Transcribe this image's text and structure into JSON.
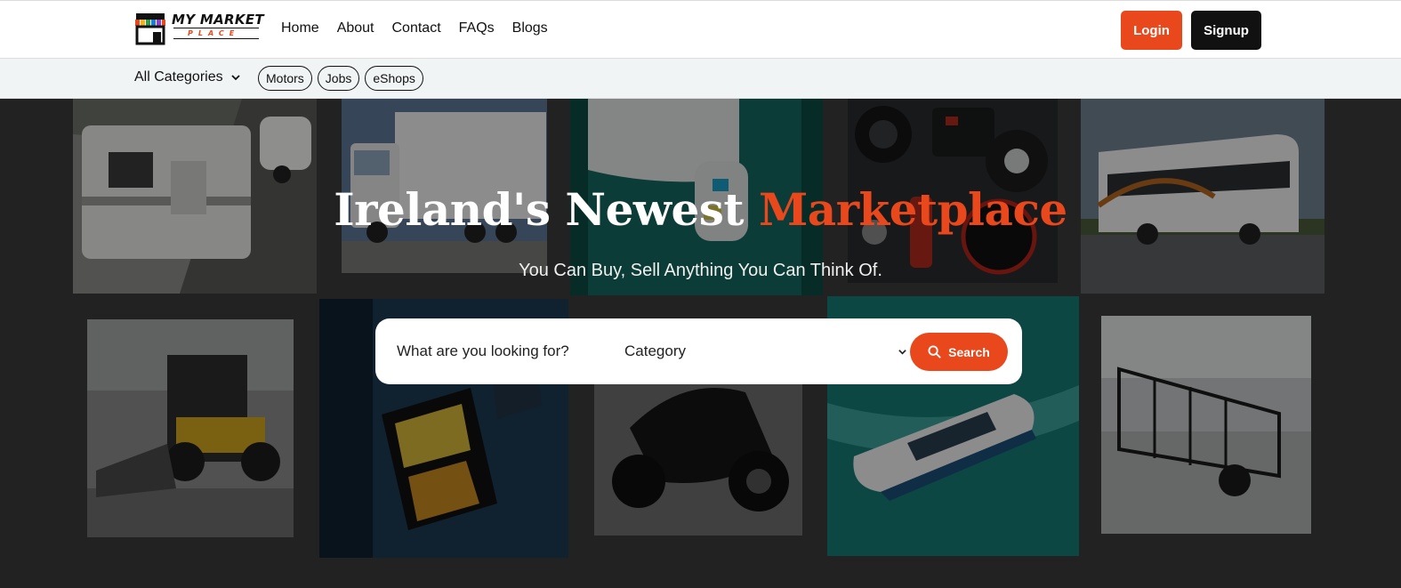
{
  "brand": {
    "name": "MY MARKET",
    "sub": "PLACE"
  },
  "nav": [
    {
      "label": "Home"
    },
    {
      "label": "About"
    },
    {
      "label": "Contact"
    },
    {
      "label": "FAQs"
    },
    {
      "label": "Blogs"
    }
  ],
  "auth": {
    "login": "Login",
    "signup": "Signup"
  },
  "categories": {
    "all_label": "All Categories",
    "pills": [
      {
        "label": "Motors"
      },
      {
        "label": "Jobs"
      },
      {
        "label": "eShops"
      }
    ]
  },
  "hero": {
    "title_main": "Ireland's Newest",
    "title_accent": "Marketplace",
    "subtitle": "You Can Buy, Sell Anything You Can Think Of.",
    "tiles": [
      "caravan",
      "truck",
      "boat-part",
      "car-parts",
      "coach-bus",
      "loader",
      "marine-electronics",
      "scooter",
      "speedboat",
      "trailer"
    ]
  },
  "search": {
    "placeholder": "What are you looking for?",
    "category_label": "Category",
    "button_label": "Search"
  },
  "colors": {
    "accent": "#e8481c",
    "dark": "#111111",
    "catbar": "#f1f4f5"
  }
}
